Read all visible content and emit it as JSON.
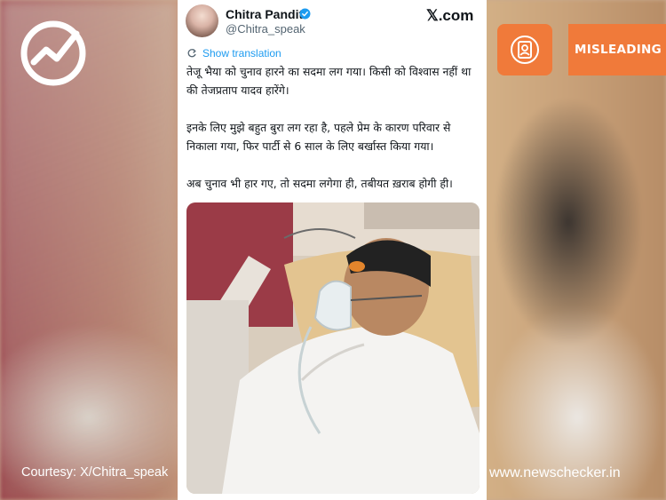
{
  "overlay": {
    "label": "MISLEADING",
    "courtesy": "Courtesy: X/Chitra_speak",
    "site": "www.newschecker.in"
  },
  "tweet": {
    "name": "Chitra Pandit",
    "handle": "@Chitra_speak",
    "brand": "𝕏.com",
    "translate": "Show translation",
    "lines": [
      "तेजू भैया को चुनाव हारने का सदमा लग गया। किसी को विश्वास नहीं था की तेजप्रताप यादव हारेंगे।",
      "इनके लिए मुझे बहुत बुरा लग रहा है, पहले प्रेम के कारण परिवार से निकाला गया, फिर पार्टी से 6 साल के लिए बर्खास्त किया गया।",
      "अब चुनाव भी हार गए, तो सदमा लगेगा ही, तबीयत ख़राब होगी ही।"
    ]
  },
  "colors": {
    "accent": "#f07a3a",
    "link": "#1d9bf0",
    "verified": "#1d9bf0"
  }
}
